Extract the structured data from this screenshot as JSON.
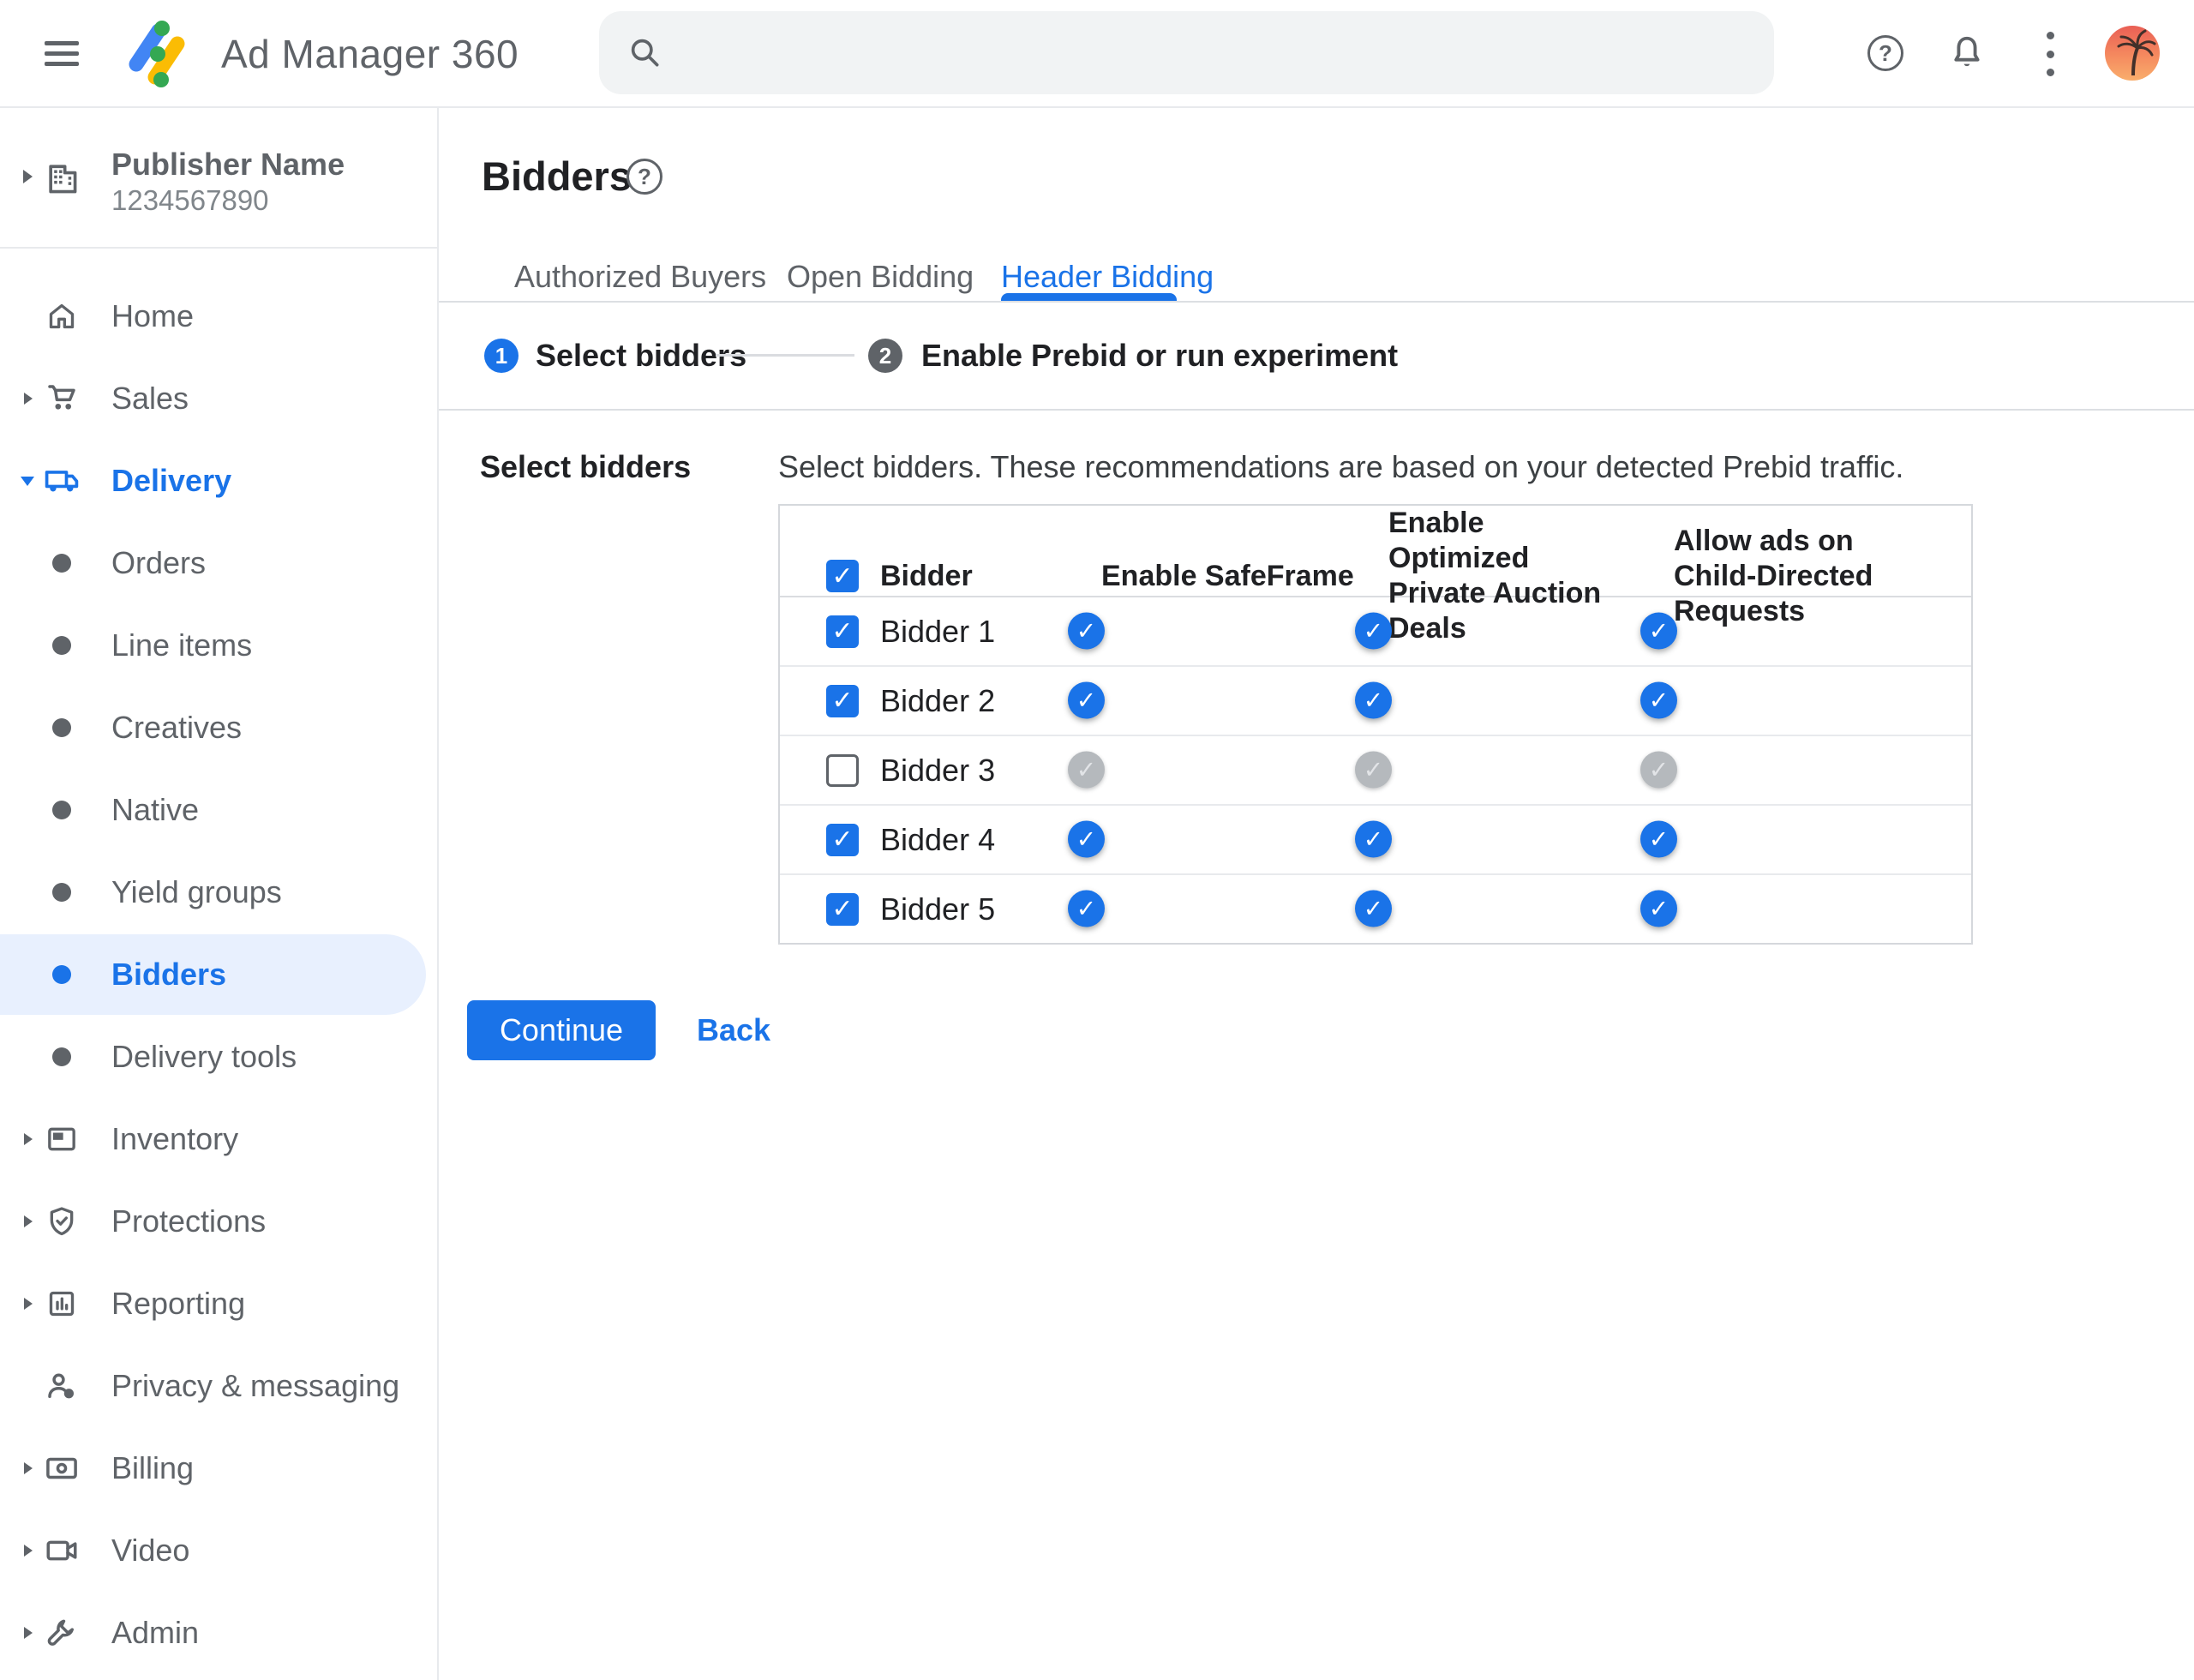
{
  "topbar": {
    "app_title": "Ad Manager 360",
    "search_value": "",
    "icons": [
      "menu-icon",
      "search-icon",
      "help-icon",
      "notifications-icon",
      "more-vert-icon",
      "avatar"
    ]
  },
  "publisher": {
    "name": "Publisher Name",
    "id": "1234567890"
  },
  "sidebar": {
    "items": [
      {
        "label": "Home"
      },
      {
        "label": "Sales"
      },
      {
        "label": "Delivery"
      },
      {
        "label": "Orders"
      },
      {
        "label": "Line items"
      },
      {
        "label": "Creatives"
      },
      {
        "label": "Native"
      },
      {
        "label": "Yield groups"
      },
      {
        "label": "Bidders"
      },
      {
        "label": "Delivery tools"
      },
      {
        "label": "Inventory"
      },
      {
        "label": "Protections"
      },
      {
        "label": "Reporting"
      },
      {
        "label": "Privacy & messaging"
      },
      {
        "label": "Billing"
      },
      {
        "label": "Video"
      },
      {
        "label": "Admin"
      }
    ],
    "selected": "Bidders"
  },
  "page": {
    "title": "Bidders",
    "help_glyph": "?"
  },
  "tabs": [
    {
      "label": "Authorized Buyers",
      "active": false
    },
    {
      "label": "Open Bidding",
      "active": false
    },
    {
      "label": "Header Bidding",
      "active": true
    }
  ],
  "stepper": {
    "steps": [
      {
        "number": "1",
        "label": "Select bidders"
      },
      {
        "number": "2",
        "label": "Enable Prebid or run experiment"
      }
    ]
  },
  "section": {
    "label": "Select bidders",
    "description": "Select bidders. These recommendations are based on your detected Prebid traffic."
  },
  "table": {
    "headers": [
      "Bidder",
      "Enable SafeFrame",
      "Enable Optimized Private Auction Deals",
      "Allow ads on Child-Directed Requests"
    ],
    "select_all_checked": true,
    "rows": [
      {
        "name": "Bidder 1",
        "selected": true,
        "toggles": [
          true,
          true,
          true
        ]
      },
      {
        "name": "Bidder 2",
        "selected": true,
        "toggles": [
          true,
          true,
          true
        ]
      },
      {
        "name": "Bidder 3",
        "selected": false,
        "toggles": [
          false,
          false,
          false
        ]
      },
      {
        "name": "Bidder 4",
        "selected": true,
        "toggles": [
          true,
          true,
          true
        ]
      },
      {
        "name": "Bidder 5",
        "selected": true,
        "toggles": [
          true,
          true,
          true
        ]
      }
    ]
  },
  "actions": {
    "continue_label": "Continue",
    "back_label": "Back"
  },
  "colors": {
    "accent": "#1a73e8",
    "selected_bg": "#e8f0fe",
    "toggle_track_on": "#8fb5f5",
    "text_gray": "#5f6368"
  }
}
